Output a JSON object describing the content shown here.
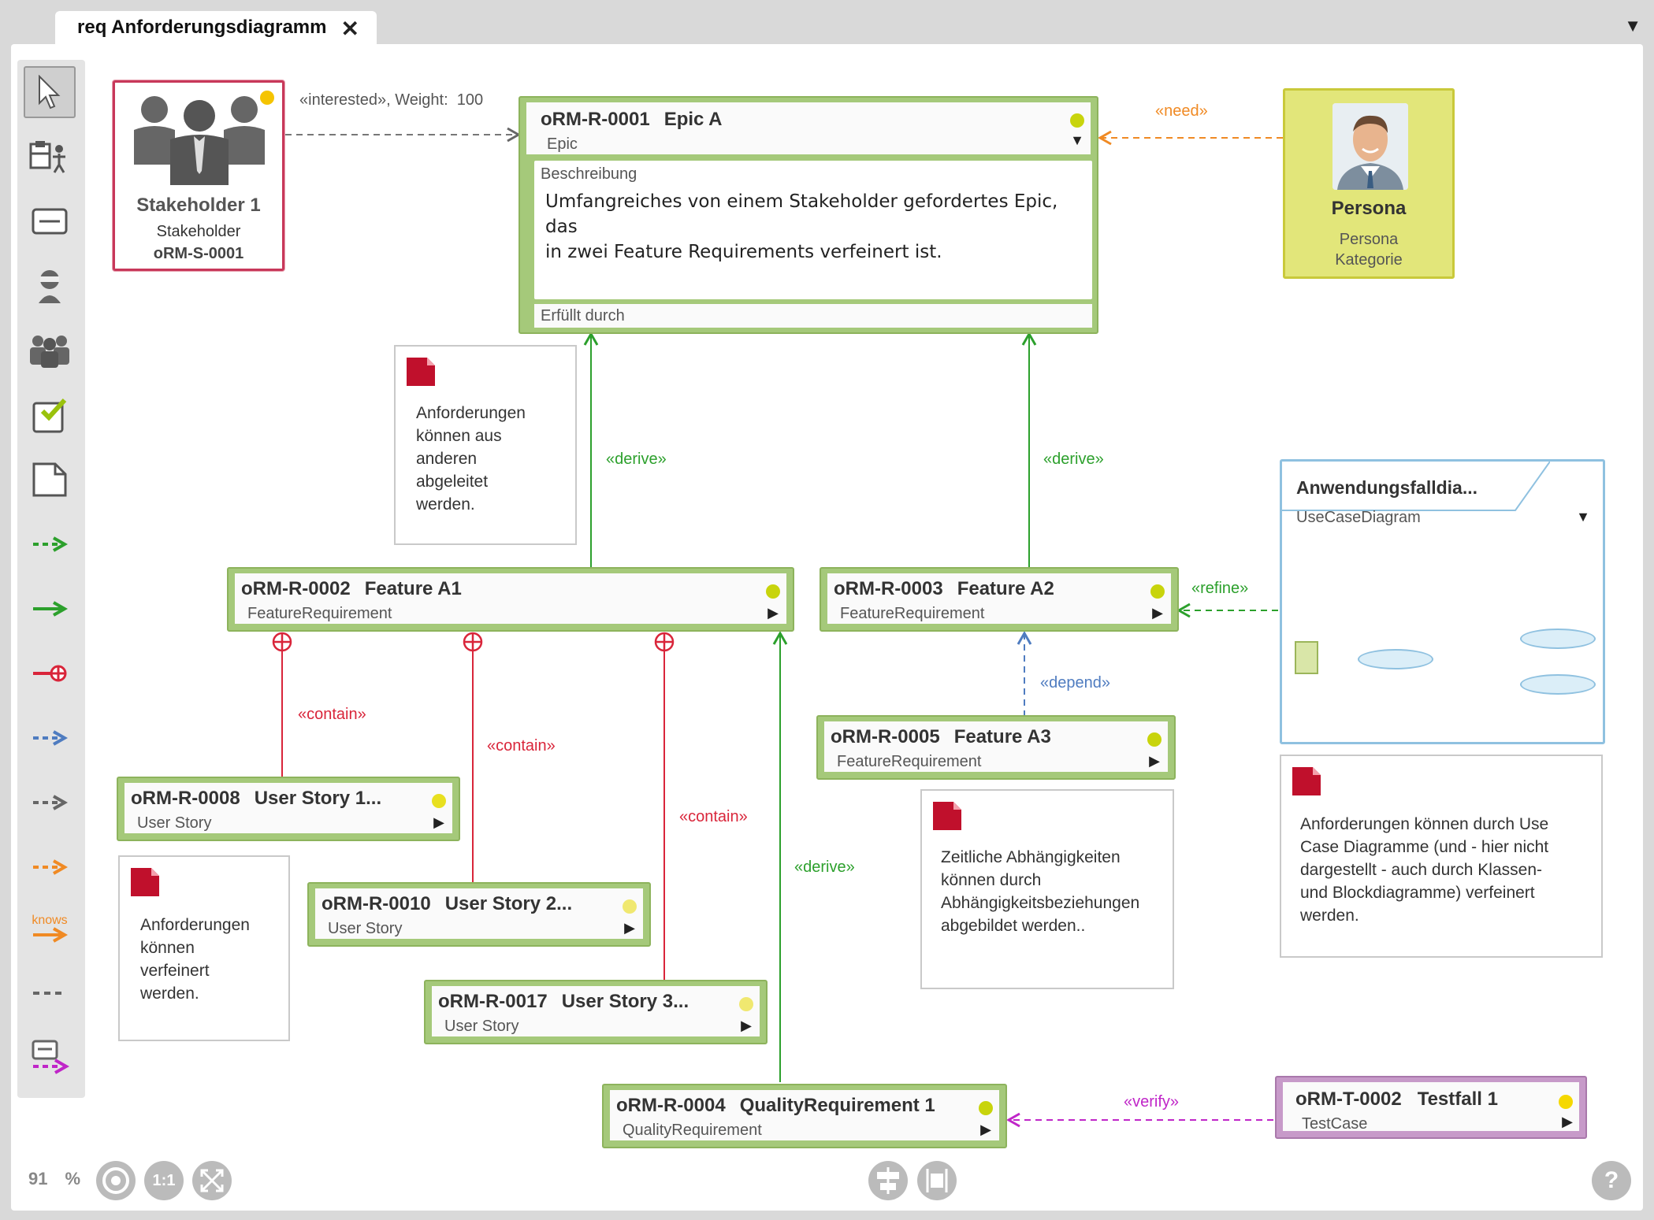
{
  "tab": {
    "title": "req Anforderungsdiagramm",
    "close": "✕",
    "menu": "▼"
  },
  "zoom": {
    "value": "91",
    "unit": "%",
    "one_to_one": "1:1"
  },
  "help": "?",
  "toolbar_knows": "knows",
  "stakeholder": {
    "name": "Stakeholder 1",
    "type": "Stakeholder",
    "id": "oRM-S-0001"
  },
  "persona": {
    "name": "Persona",
    "type": "Persona",
    "category": "Kategorie"
  },
  "epic": {
    "id": "oRM-R-0001",
    "name": "Epic A",
    "type": "Epic",
    "desc_label": "Beschreibung",
    "desc_line1": "Umfangreiches von einem Stakeholder gefordertes Epic, das",
    "desc_line2": "in zwei Feature Requirements verfeinert ist.",
    "fulfilled_label": "Erfüllt durch"
  },
  "requirements": [
    {
      "id": "oRM-R-0002",
      "name": "Feature A1",
      "type": "FeatureRequirement"
    },
    {
      "id": "oRM-R-0003",
      "name": "Feature A2",
      "type": "FeatureRequirement"
    },
    {
      "id": "oRM-R-0005",
      "name": "Feature A3",
      "type": "FeatureRequirement"
    },
    {
      "id": "oRM-R-0008",
      "name": "User Story 1...",
      "type": "User Story"
    },
    {
      "id": "oRM-R-0010",
      "name": "User Story 2...",
      "type": "User Story"
    },
    {
      "id": "oRM-R-0017",
      "name": "User Story 3...",
      "type": "User Story"
    },
    {
      "id": "oRM-R-0004",
      "name": "QualityRequirement 1",
      "type": "QualityRequirement"
    }
  ],
  "testcase": {
    "id": "oRM-T-0002",
    "name": "Testfall 1",
    "type": "TestCase"
  },
  "usecase": {
    "name": "Anwendungsfalldia...",
    "type": "UseCaseDiagram"
  },
  "notes": {
    "derive": [
      "Anforderungen",
      "können aus",
      "anderen",
      "abgeleitet",
      "werden."
    ],
    "refine": [
      "Anforderungen",
      "können",
      "verfeinert",
      "werden."
    ],
    "depend": [
      "Zeitliche Abhängigkeiten",
      "können durch",
      "Abhängigkeitsbeziehungen",
      "abgebildet werden.."
    ],
    "usecase": [
      "Anforderungen können durch Use",
      "Case Diagramme (und - hier nicht",
      "dargestellt - auch durch Klassen-",
      "und Blockdiagramme) verfeinert",
      "werden."
    ]
  },
  "edge_labels": {
    "interested": "«interested», Weight:",
    "weight": "100",
    "need": "«need»",
    "derive": "«derive»",
    "contain": "«contain»",
    "refine": "«refine»",
    "depend": "«depend»",
    "verify": "«verify»"
  },
  "colors": {
    "req_fill": "#a5c97a",
    "stakeholder_border": "#c8385a",
    "persona_fill": "#e2e67a",
    "derive": "#2ca02c",
    "contain": "#d9253a",
    "need": "#f08a24",
    "depend": "#4f7cc0",
    "refine": "#2ca02c",
    "verify": "#c026c8",
    "usecase_border": "#8fc1e0",
    "testcase": "#c79ac9"
  }
}
